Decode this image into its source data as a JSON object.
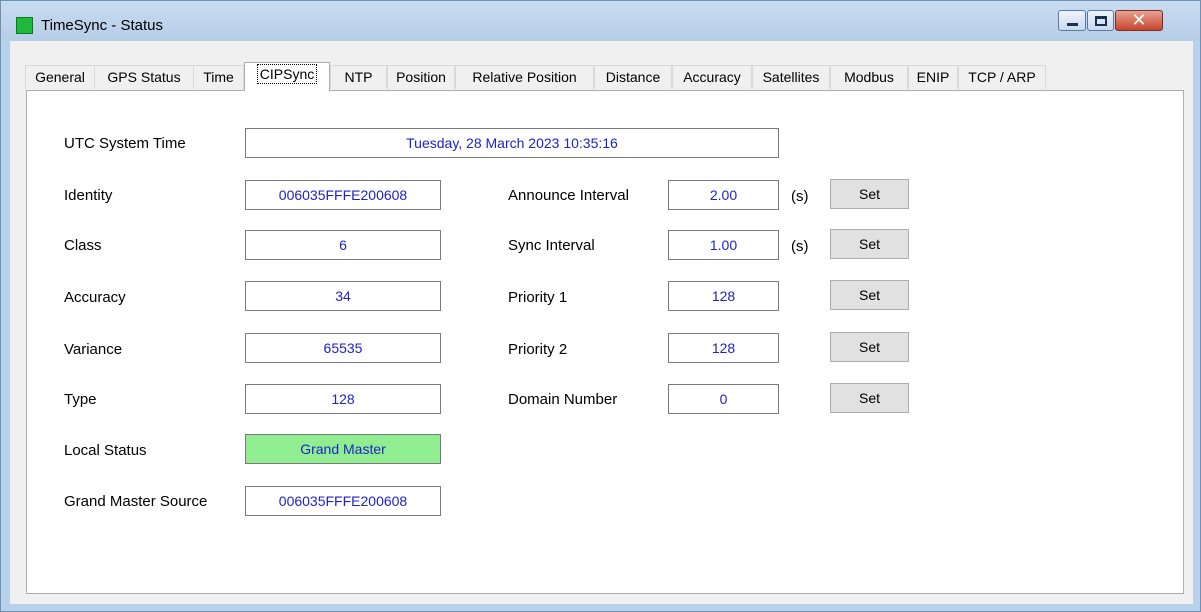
{
  "window": {
    "title": "TimeSync - Status",
    "icon_color": "#1db83c"
  },
  "tabs": [
    {
      "label": "General"
    },
    {
      "label": "GPS Status"
    },
    {
      "label": "Time"
    },
    {
      "label": "CIPSync",
      "active": true
    },
    {
      "label": "NTP"
    },
    {
      "label": "Position"
    },
    {
      "label": "Relative Position"
    },
    {
      "label": "Distance"
    },
    {
      "label": "Accuracy"
    },
    {
      "label": "Satellites"
    },
    {
      "label": "Modbus"
    },
    {
      "label": "ENIP"
    },
    {
      "label": "TCP / ARP"
    }
  ],
  "cipsync": {
    "utc_system_time": {
      "label": "UTC System Time",
      "value": "Tuesday, 28 March 2023 10:35:16"
    },
    "identity": {
      "label": "Identity",
      "value": "006035FFFE200608"
    },
    "class": {
      "label": "Class",
      "value": "6"
    },
    "accuracy": {
      "label": "Accuracy",
      "value": "34"
    },
    "variance": {
      "label": "Variance",
      "value": "65535"
    },
    "type": {
      "label": "Type",
      "value": "128"
    },
    "local_status": {
      "label": "Local Status",
      "value": "Grand Master",
      "color": "#90ee90"
    },
    "gm_source": {
      "label": "Grand Master Source",
      "value": "006035FFFE200608"
    },
    "announce_interval": {
      "label": "Announce Interval",
      "value": "2.00",
      "unit": "(s)",
      "button": "Set"
    },
    "sync_interval": {
      "label": "Sync Interval",
      "value": "1.00",
      "unit": "(s)",
      "button": "Set"
    },
    "priority1": {
      "label": "Priority 1",
      "value": "128",
      "button": "Set"
    },
    "priority2": {
      "label": "Priority 2",
      "value": "128",
      "button": "Set"
    },
    "domain_number": {
      "label": "Domain Number",
      "value": "0",
      "button": "Set"
    }
  },
  "colors": {
    "value_text": "#1f22c8",
    "title_bar": "#b9d1ea",
    "close_button": "#c8452c"
  }
}
